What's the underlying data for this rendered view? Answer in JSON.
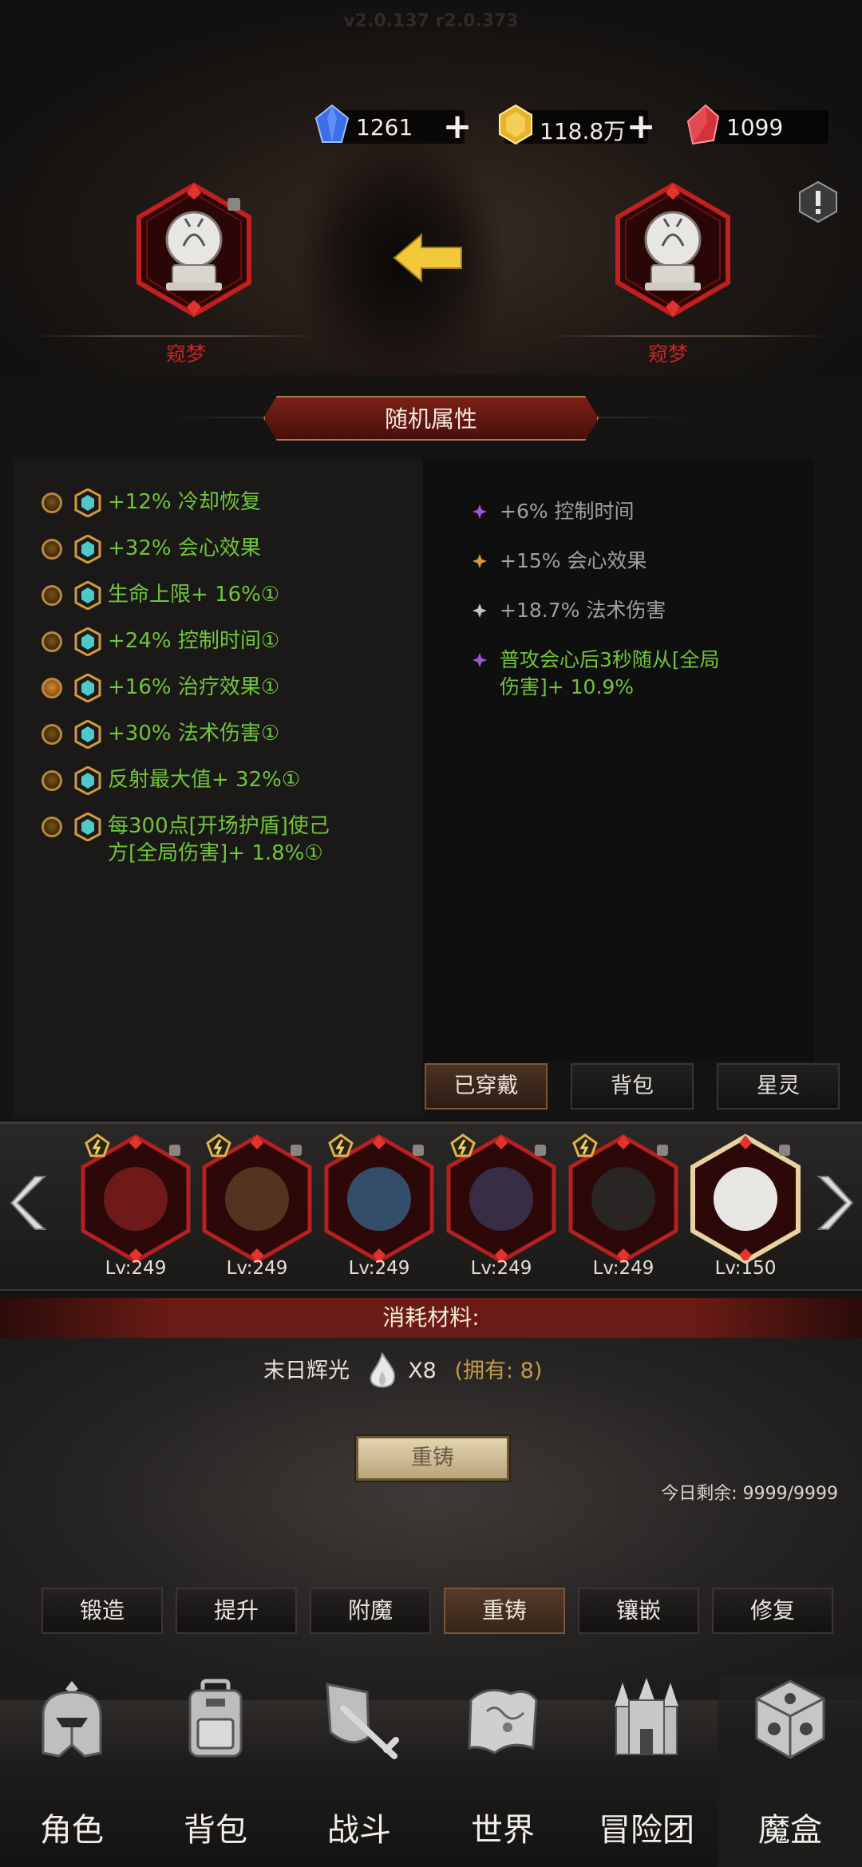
{
  "version": "v2.0.137 r2.0.373",
  "resources": [
    {
      "icon": "blue-diamond-icon",
      "value": "1261",
      "has_plus": true,
      "color": "#3c6ee8"
    },
    {
      "icon": "gold-diamond-icon",
      "value": "118.8万",
      "has_plus": true,
      "color": "#e6b32a"
    },
    {
      "icon": "red-crystal-icon",
      "value": "1099",
      "has_plus": false,
      "color": "#d3323b"
    }
  ],
  "compare": {
    "left_name": "窥梦",
    "right_name": "窥梦"
  },
  "attributes": {
    "title": "随机属性",
    "left": [
      {
        "text": "+12% 冷却恢复",
        "selected": false
      },
      {
        "text": "+32% 会心效果",
        "selected": false
      },
      {
        "text": "生命上限+ 16%①",
        "selected": false
      },
      {
        "text": "+24% 控制时间①",
        "selected": false
      },
      {
        "text": "+16% 治疗效果①",
        "selected": true
      },
      {
        "text": "+30% 法术伤害①",
        "selected": false
      },
      {
        "text": "反射最大值+ 32%①",
        "selected": false
      },
      {
        "text": "每300点[开场护盾]使己\n方[全局伤害]+ 1.8%①",
        "selected": false
      }
    ],
    "right": [
      {
        "text": "+6% 控制时间",
        "color": "#a3a09c",
        "icon_color": "#9b59d6"
      },
      {
        "text": "+15% 会心效果",
        "color": "#a3a09c",
        "icon_color": "#d69a3c"
      },
      {
        "text": "+18.7% 法术伤害",
        "color": "#a3a09c",
        "icon_color": "#cdc3b5"
      },
      {
        "text": "普攻会心后3秒随从[全局\n伤害]+ 10.9%",
        "color": "#71c43b",
        "icon_color": "#9b59d6"
      }
    ]
  },
  "tabs": [
    "已穿戴",
    "背包",
    "星灵"
  ],
  "active_tab": 0,
  "equipment": [
    {
      "icon": "gauntlet-icon",
      "level": "Lv:249"
    },
    {
      "icon": "boots-icon",
      "level": "Lv:249"
    },
    {
      "icon": "amulet-icon",
      "level": "Lv:249"
    },
    {
      "icon": "octopus-belt-icon",
      "level": "Lv:249"
    },
    {
      "icon": "robe-icon",
      "level": "Lv:249"
    },
    {
      "icon": "snow-globe-icon",
      "level": "Lv:150"
    }
  ],
  "materials": {
    "title": "消耗材料:",
    "name": "末日辉光",
    "count": "X8",
    "owned": "(拥有: 8)"
  },
  "recast_button": "重铸",
  "today_remaining": "今日剩余: 9999/9999",
  "functions": [
    "锻造",
    "提升",
    "附魔",
    "重铸",
    "镶嵌",
    "修复"
  ],
  "active_function": 3,
  "bottom_nav": [
    {
      "label": "角色",
      "icon": "helmet-icon"
    },
    {
      "label": "背包",
      "icon": "backpack-icon"
    },
    {
      "label": "战斗",
      "icon": "sword-shield-icon"
    },
    {
      "label": "世界",
      "icon": "map-icon"
    },
    {
      "label": "冒险团",
      "icon": "castle-icon"
    },
    {
      "label": "魔盒",
      "icon": "magic-cube-icon"
    }
  ],
  "active_nav": 5
}
